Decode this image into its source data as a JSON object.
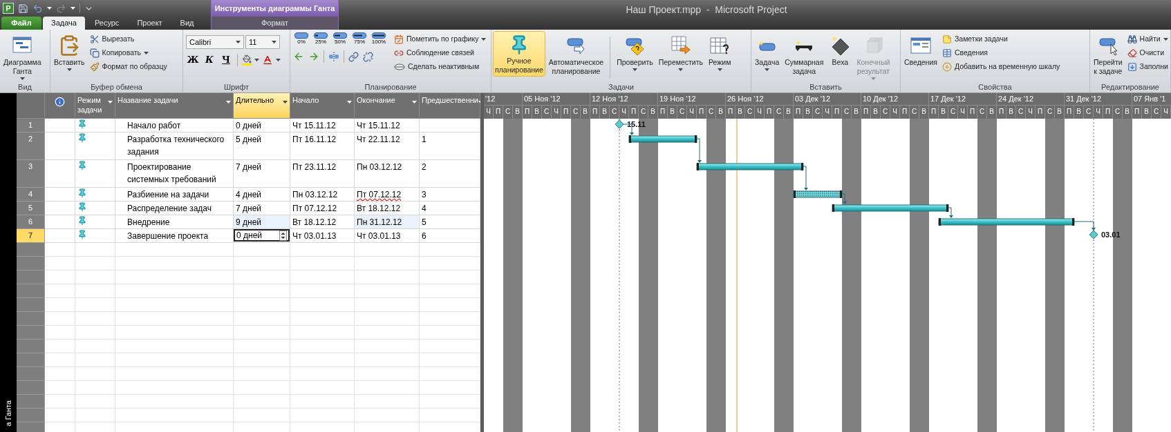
{
  "window": {
    "title": "Наш Проект.mpp  -  Microsoft Project",
    "app_letter": "P"
  },
  "tabs": [
    {
      "label": "Файл",
      "kind": "file",
      "selected": false
    },
    {
      "label": "Задача",
      "kind": "tab",
      "selected": true
    },
    {
      "label": "Ресурс",
      "kind": "tab",
      "selected": false
    },
    {
      "label": "Проект",
      "kind": "tab",
      "selected": false
    },
    {
      "label": "Вид",
      "kind": "tab",
      "selected": false
    }
  ],
  "contextual": {
    "title": "Инструменты диаграммы Ганта",
    "tabs": [
      {
        "label": "Формат",
        "selected": false
      }
    ]
  },
  "ribbon": [
    {
      "label": "Вид",
      "kind": "basic",
      "large": [
        {
          "label": "Диаграмма\nГанта",
          "dropdown": true,
          "selected": false,
          "disabled": false
        }
      ]
    },
    {
      "label": "Буфер обмена",
      "kind": "basic",
      "large": [
        {
          "label": "Вставить",
          "dropdown": true,
          "selected": false,
          "disabled": false
        }
      ],
      "small": [
        {
          "label": "Вырезать",
          "dropdown": false
        },
        {
          "label": "Копировать",
          "dropdown": true
        },
        {
          "label": "Формат по образцу",
          "dropdown": false
        }
      ]
    },
    {
      "label": "Шрифт",
      "kind": "font",
      "font": "Calibri",
      "size": "11",
      "format_buttons": [
        "Ж",
        "К",
        "Ч"
      ]
    },
    {
      "label": "Планирование",
      "kind": "scheduling",
      "percent_buttons": [
        "0%",
        "25%",
        "50%",
        "75%",
        "100%"
      ],
      "small": [
        {
          "label": "Пометить по графику",
          "dropdown": true
        },
        {
          "label": "Соблюдение связей",
          "dropdown": false
        },
        {
          "label": "Сделать неактивным",
          "dropdown": false
        }
      ]
    },
    {
      "label": "Задачи",
      "kind": "basic",
      "large": [
        {
          "label": "Ручное\nпланирование",
          "dropdown": false,
          "selected": true,
          "disabled": false
        },
        {
          "label": "Автоматическое\nпланирование",
          "dropdown": false,
          "selected": false,
          "disabled": false
        },
        {
          "label": "Проверить",
          "dropdown": true,
          "selected": false,
          "disabled": false
        },
        {
          "label": "Переместить",
          "dropdown": true,
          "selected": false,
          "disabled": false
        },
        {
          "label": "Режим",
          "dropdown": true,
          "selected": false,
          "disabled": false
        }
      ]
    },
    {
      "label": "Вставить",
      "kind": "basic",
      "large": [
        {
          "label": "Задача",
          "dropdown": true,
          "selected": false,
          "disabled": false
        },
        {
          "label": "Суммарная\nзадача",
          "dropdown": false,
          "selected": false,
          "disabled": false
        },
        {
          "label": "Веха",
          "dropdown": false,
          "selected": false,
          "disabled": false
        },
        {
          "label": "Конечный\nрезультат",
          "dropdown": true,
          "selected": false,
          "disabled": true
        }
      ]
    },
    {
      "label": "Свойства",
      "kind": "basic",
      "large": [
        {
          "label": "Сведения",
          "dropdown": false,
          "selected": false,
          "disabled": false
        }
      ],
      "small": [
        {
          "label": "Заметки задачи",
          "dropdown": false
        },
        {
          "label": "Сведения",
          "dropdown": false
        },
        {
          "label": "Добавить на временную шкалу",
          "dropdown": false
        }
      ]
    },
    {
      "label": "Редактирование",
      "kind": "basic",
      "large": [
        {
          "label": "Перейти\nк задаче",
          "dropdown": false,
          "selected": false,
          "disabled": false
        }
      ],
      "small": [
        {
          "label": "Найти",
          "dropdown": true
        },
        {
          "label": "Очисти",
          "dropdown": false
        },
        {
          "label": "Заполни",
          "dropdown": false
        }
      ]
    }
  ],
  "view_bar": {
    "label": "а Ганта"
  },
  "table": {
    "columns": [
      {
        "kind": "info",
        "selected": false
      },
      {
        "kind": "mode",
        "label": "Режим задачи",
        "selected": false
      },
      {
        "kind": "name",
        "label": "Название задачи",
        "selected": false
      },
      {
        "kind": "duration",
        "label": "Длительно",
        "selected": true
      },
      {
        "kind": "start",
        "label": "Начало",
        "selected": false
      },
      {
        "kind": "finish",
        "label": "Окончание",
        "selected": false
      },
      {
        "kind": "predecessors",
        "label": "Предшественни",
        "selected": false
      }
    ],
    "rows": [
      {
        "id": "1",
        "name": "Начало работ",
        "duration": "0 дней",
        "start": "Чт 15.11.12",
        "finish": "Чт 15.11.12",
        "kind": "milestone",
        "selected": false,
        "changed": false,
        "editing": false,
        "finish_flagged": false
      },
      {
        "id": "2",
        "name": "Разработка технического задания",
        "duration": "5 дней",
        "start": "Пт 16.11.12",
        "finish": "Чт 22.11.12",
        "predecessors": "1",
        "kind": "task",
        "hatched": false,
        "selected": false,
        "changed": false,
        "editing": false,
        "finish_flagged": false
      },
      {
        "id": "3",
        "name": "Проектирование системных требований",
        "duration": "7 дней",
        "start": "Пт 23.11.12",
        "finish": "Пн 03.12.12",
        "predecessors": "2",
        "kind": "task",
        "hatched": false,
        "selected": false,
        "changed": false,
        "editing": false,
        "finish_flagged": false
      },
      {
        "id": "4",
        "name": "Разбиение на задачи",
        "duration": "4 дней",
        "start": "Пн 03.12.12",
        "finish": "Пт 07.12.12",
        "predecessors": "3",
        "kind": "task",
        "hatched": true,
        "selected": false,
        "changed": false,
        "editing": false,
        "finish_flagged": true
      },
      {
        "id": "5",
        "name": "Распределение задач",
        "duration": "7 дней",
        "start": "Пт 07.12.12",
        "finish": "Вт 18.12.12",
        "predecessors": "4",
        "kind": "task",
        "hatched": false,
        "selected": false,
        "changed": false,
        "editing": false,
        "finish_flagged": false
      },
      {
        "id": "6",
        "name": "Внедрение",
        "duration": "9 дней",
        "start": "Вт 18.12.12",
        "finish": "Пн 31.12.12",
        "predecessors": "5",
        "kind": "task",
        "hatched": false,
        "selected": false,
        "changed": true,
        "editing": false,
        "finish_flagged": false
      },
      {
        "id": "7",
        "name": "Завершение проекта",
        "duration": "0 дней",
        "start": "Чт 03.01.13",
        "finish": "Чт 03.01.13",
        "predecessors": "6",
        "kind": "milestone",
        "selected": true,
        "changed": false,
        "editing": true,
        "finish_flagged": false
      }
    ]
  },
  "gantt": {
    "milestone_labels": [
      "15.11",
      "03.01"
    ],
    "weeks": [
      "'12",
      "05 Ноя '12",
      "12 Ноя '12",
      "19 Ноя '12",
      "26 Ноя '12",
      "03 Дек '12",
      "10 Дек '12",
      "17 Дек '12",
      "24 Дек '12",
      "31 Дек '12",
      "07 Янв '1"
    ],
    "days": [
      {
        "label": "Ч",
        "weekend": false
      },
      {
        "label": "П",
        "weekend": false
      },
      {
        "label": "С",
        "weekend": true
      },
      {
        "label": "В",
        "weekend": true
      },
      {
        "label": "П",
        "weekend": false
      },
      {
        "label": "В",
        "weekend": false
      },
      {
        "label": "С",
        "weekend": false
      },
      {
        "label": "Ч",
        "weekend": false
      },
      {
        "label": "П",
        "weekend": false
      },
      {
        "label": "С",
        "weekend": true
      },
      {
        "label": "В",
        "weekend": true
      },
      {
        "label": "П",
        "weekend": false
      },
      {
        "label": "В",
        "weekend": false
      },
      {
        "label": "С",
        "weekend": false
      },
      {
        "label": "Ч",
        "weekend": false
      },
      {
        "label": "П",
        "weekend": false
      },
      {
        "label": "С",
        "weekend": true
      },
      {
        "label": "В",
        "weekend": true
      },
      {
        "label": "П",
        "weekend": false
      },
      {
        "label": "В",
        "weekend": false
      },
      {
        "label": "С",
        "weekend": false
      },
      {
        "label": "Ч",
        "weekend": false
      },
      {
        "label": "П",
        "weekend": false
      },
      {
        "label": "С",
        "weekend": true
      },
      {
        "label": "В",
        "weekend": true
      },
      {
        "label": "П",
        "weekend": false
      },
      {
        "label": "В",
        "weekend": false
      },
      {
        "label": "С",
        "weekend": false
      },
      {
        "label": "Ч",
        "weekend": false
      },
      {
        "label": "П",
        "weekend": false
      },
      {
        "label": "С",
        "weekend": true
      },
      {
        "label": "В",
        "weekend": true
      },
      {
        "label": "П",
        "weekend": false
      },
      {
        "label": "В",
        "weekend": false
      },
      {
        "label": "С",
        "weekend": false
      },
      {
        "label": "Ч",
        "weekend": false
      },
      {
        "label": "П",
        "weekend": false
      },
      {
        "label": "С",
        "weekend": true
      },
      {
        "label": "В",
        "weekend": true
      },
      {
        "label": "П",
        "weekend": false
      },
      {
        "label": "В",
        "weekend": false
      },
      {
        "label": "С",
        "weekend": false
      },
      {
        "label": "Ч",
        "weekend": false
      },
      {
        "label": "П",
        "weekend": false
      },
      {
        "label": "С",
        "weekend": true
      },
      {
        "label": "В",
        "weekend": true
      },
      {
        "label": "П",
        "weekend": false
      },
      {
        "label": "В",
        "weekend": false
      },
      {
        "label": "С",
        "weekend": false
      },
      {
        "label": "Ч",
        "weekend": false
      },
      {
        "label": "П",
        "weekend": false
      },
      {
        "label": "С",
        "weekend": true
      },
      {
        "label": "В",
        "weekend": true
      },
      {
        "label": "П",
        "weekend": false
      },
      {
        "label": "В",
        "weekend": false
      },
      {
        "label": "С",
        "weekend": false
      },
      {
        "label": "Ч",
        "weekend": false
      },
      {
        "label": "П",
        "weekend": false
      },
      {
        "label": "С",
        "weekend": true
      },
      {
        "label": "В",
        "weekend": true
      },
      {
        "label": "П",
        "weekend": false
      },
      {
        "label": "В",
        "weekend": false
      },
      {
        "label": "С",
        "weekend": false
      },
      {
        "label": "Ч",
        "weekend": false
      },
      {
        "label": "П",
        "weekend": false
      },
      {
        "label": "С",
        "weekend": true
      },
      {
        "label": "В",
        "weekend": true
      },
      {
        "label": "П",
        "weekend": false
      },
      {
        "label": "В",
        "weekend": false
      },
      {
        "label": "С",
        "weekend": false
      },
      {
        "label": "Ч",
        "weekend": false
      }
    ]
  }
}
